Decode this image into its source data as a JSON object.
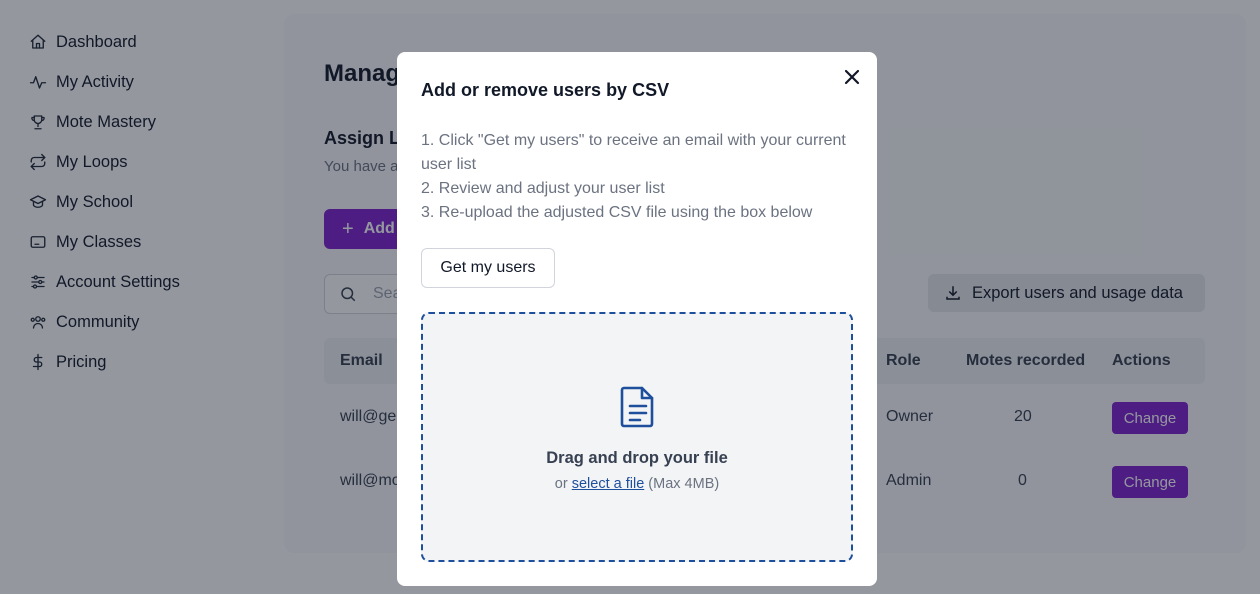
{
  "sidebar": {
    "items": [
      {
        "label": "Dashboard",
        "icon": "home-icon"
      },
      {
        "label": "My Activity",
        "icon": "activity-icon"
      },
      {
        "label": "Mote Mastery",
        "icon": "trophy-icon"
      },
      {
        "label": "My Loops",
        "icon": "repeat-icon"
      },
      {
        "label": "My School",
        "icon": "graduation-cap-icon"
      },
      {
        "label": "My Classes",
        "icon": "screen-icon"
      },
      {
        "label": "Account Settings",
        "icon": "sliders-icon"
      },
      {
        "label": "Community",
        "icon": "users-icon"
      },
      {
        "label": "Pricing",
        "icon": "dollar-icon"
      }
    ]
  },
  "main": {
    "title": "Manag",
    "section_title": "Assign L",
    "section_sub": "You have a",
    "add_button": "Add",
    "search_placeholder": "Sea",
    "export_button": "Export users and usage data",
    "table": {
      "headers": {
        "email": "Email",
        "role": "Role",
        "motes": "Motes recorded",
        "actions": "Actions"
      },
      "rows": [
        {
          "email": "will@ge",
          "role": "Owner",
          "motes": "20",
          "action": "Change"
        },
        {
          "email": "will@mo",
          "role": "Admin",
          "motes": "0",
          "action": "Change"
        }
      ]
    }
  },
  "modal": {
    "title": "Add or remove users by CSV",
    "steps": [
      "1. Click \"Get my users\" to receive an email with your current user list",
      "2. Review and adjust your user list",
      "3. Re-upload the adjusted CSV file using the box below"
    ],
    "get_users_button": "Get my users",
    "dropzone": {
      "title": "Drag and drop your file",
      "prefix": "or",
      "link": "select a file",
      "limit": "(Max 4MB)"
    }
  },
  "colors": {
    "accent": "#7e22ce",
    "dropzone_border": "#1e4f9c",
    "overlay": "rgba(17,24,39,0.45)"
  }
}
